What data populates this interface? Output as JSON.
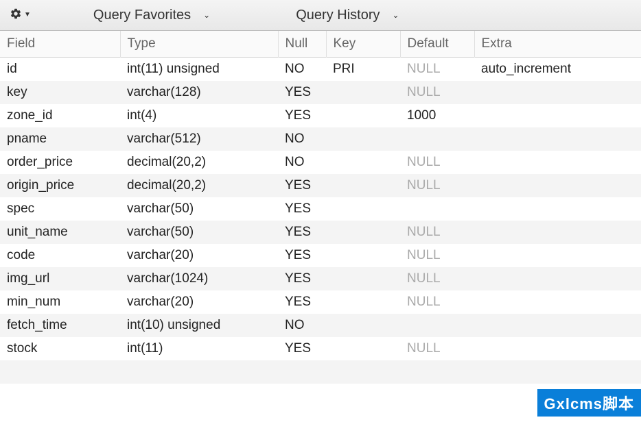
{
  "toolbar": {
    "query_favorites": "Query Favorites",
    "query_history": "Query History"
  },
  "columns": {
    "field": "Field",
    "type": "Type",
    "null": "Null",
    "key": "Key",
    "default": "Default",
    "extra": "Extra"
  },
  "rows": [
    {
      "field": "id",
      "type": "int(11) unsigned",
      "null": "NO",
      "key": "PRI",
      "default": "NULL",
      "default_is_null": true,
      "extra": "auto_increment"
    },
    {
      "field": "key",
      "type": "varchar(128)",
      "null": "YES",
      "key": "",
      "default": "NULL",
      "default_is_null": true,
      "extra": ""
    },
    {
      "field": "zone_id",
      "type": "int(4)",
      "null": "YES",
      "key": "",
      "default": "1000",
      "default_is_null": false,
      "extra": ""
    },
    {
      "field": "pname",
      "type": "varchar(512)",
      "null": "NO",
      "key": "",
      "default": "",
      "default_is_null": false,
      "extra": ""
    },
    {
      "field": "order_price",
      "type": "decimal(20,2)",
      "null": "NO",
      "key": "",
      "default": "NULL",
      "default_is_null": true,
      "extra": ""
    },
    {
      "field": "origin_price",
      "type": "decimal(20,2)",
      "null": "YES",
      "key": "",
      "default": "NULL",
      "default_is_null": true,
      "extra": ""
    },
    {
      "field": "spec",
      "type": "varchar(50)",
      "null": "YES",
      "key": "",
      "default": "",
      "default_is_null": false,
      "extra": ""
    },
    {
      "field": "unit_name",
      "type": "varchar(50)",
      "null": "YES",
      "key": "",
      "default": "NULL",
      "default_is_null": true,
      "extra": ""
    },
    {
      "field": "code",
      "type": "varchar(20)",
      "null": "YES",
      "key": "",
      "default": "NULL",
      "default_is_null": true,
      "extra": ""
    },
    {
      "field": "img_url",
      "type": "varchar(1024)",
      "null": "YES",
      "key": "",
      "default": "NULL",
      "default_is_null": true,
      "extra": ""
    },
    {
      "field": "min_num",
      "type": "varchar(20)",
      "null": "YES",
      "key": "",
      "default": "NULL",
      "default_is_null": true,
      "extra": ""
    },
    {
      "field": "fetch_time",
      "type": "int(10) unsigned",
      "null": "NO",
      "key": "",
      "default": "",
      "default_is_null": false,
      "extra": ""
    },
    {
      "field": "stock",
      "type": "int(11)",
      "null": "YES",
      "key": "",
      "default": "NULL",
      "default_is_null": true,
      "extra": ""
    }
  ],
  "watermark": "Gxlcms脚本"
}
